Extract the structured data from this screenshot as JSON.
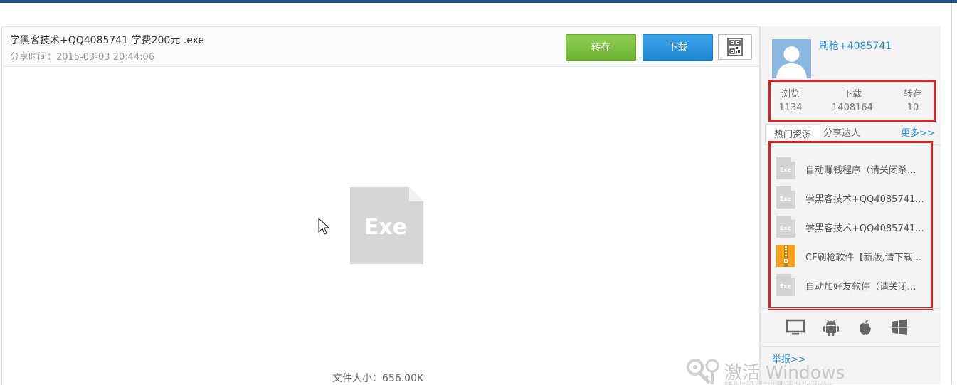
{
  "file": {
    "title": "学黑客技术+QQ4085741 学费200元 .exe",
    "share_time": "分享时间：2015-03-03 20:44:06",
    "big_icon_label": "Exe",
    "size": "文件大小：656.00K"
  },
  "actions": {
    "save_label": "转存",
    "download_label": "下载",
    "qr_icon": "qr-code-icon"
  },
  "sidebar": {
    "username": "刷枪+4085741",
    "stats": [
      {
        "label": "浏览",
        "value": "1134"
      },
      {
        "label": "下载",
        "value": "1408164"
      },
      {
        "label": "转存",
        "value": "10"
      }
    ],
    "tabs": {
      "active": "热门资源",
      "second": "分享达人",
      "more": "更多>>"
    },
    "hot_items": [
      {
        "icon": "exe-file-icon",
        "icon_text": "Exe",
        "label": "自动赚钱程序（请关闭杀..."
      },
      {
        "icon": "exe-file-icon",
        "icon_text": "Exe",
        "label": "学黑客技术+QQ4085741..."
      },
      {
        "icon": "exe-file-icon",
        "icon_text": "Exe",
        "label": "学黑客技术+QQ4085741..."
      },
      {
        "icon": "zip-file-icon",
        "icon_text": "",
        "label": "CF刷枪软件【新版,请下载..."
      },
      {
        "icon": "exe-file-icon",
        "icon_text": "Exe",
        "label": "自动加好友软件（请关闭..."
      }
    ],
    "platforms": [
      "desktop-icon",
      "android-icon",
      "apple-icon",
      "windows-icon"
    ],
    "report": "举报>>"
  },
  "watermark": {
    "title": "激活 Windows",
    "subtitle": "转到“设置”以激活 Windows。"
  },
  "colors": {
    "accent_blue": "#2d8fd8",
    "save_green": "#7cc142",
    "highlight_red": "#e02020",
    "top_bar": "#1a4f80"
  }
}
